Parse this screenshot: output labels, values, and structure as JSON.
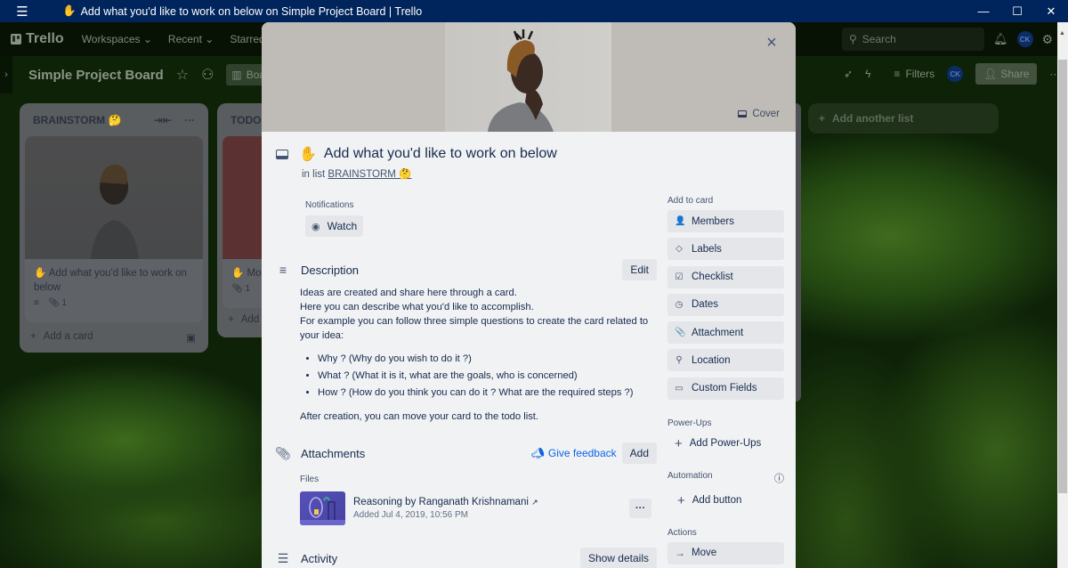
{
  "titlebar": {
    "title": "Add what you'd like to work on below on Simple Project Board | Trello",
    "title_emoji": "✋",
    "menu_icon": "hamburger-icon",
    "minimize": "—",
    "maximize": "☐",
    "close": "✕"
  },
  "topnav": {
    "brand": "Trello",
    "items": [
      {
        "label": "Workspaces",
        "chevron": "⌄"
      },
      {
        "label": "Recent",
        "chevron": "⌄"
      },
      {
        "label": "Starred",
        "chevron": "⌄"
      }
    ],
    "search_placeholder": "Search",
    "avatar_initials": "CK"
  },
  "board": {
    "name": "Simple Project Board",
    "view_button": "Board",
    "filters_label": "Filters",
    "member_initials": "CK",
    "share_label": "Share",
    "add_list_label": "Add another list"
  },
  "lists": [
    {
      "title": "BRAINSTORM 🤔",
      "card": {
        "title": "✋ Add what you'd like to work on below",
        "attachment_count": "1"
      },
      "add_card_label": "Add a card"
    },
    {
      "title": "TODO",
      "card": {
        "title": "✋ Mo",
        "attachment_count": "1"
      },
      "add_card_label": "Add"
    }
  ],
  "modal": {
    "cover_label": "Cover",
    "close_icon": "×",
    "title_emoji": "✋",
    "title": "Add what you'd like to work on below",
    "in_list_prefix": "in list",
    "list_name": "BRAINSTORM 🤔",
    "notifications_label": "Notifications",
    "watch_label": "Watch",
    "description": {
      "heading": "Description",
      "edit_label": "Edit",
      "lines": [
        "Ideas are created and share here through a card.",
        "Here you can describe what you'd like to accomplish.",
        "For example you can follow three simple questions to create the card related to your idea:"
      ],
      "bullets": [
        "Why ? (Why do you wish to do it ?)",
        "What ? (What it is it, what are the goals, who is concerned)",
        "How ? (How do you think you can do it ? What are the required steps ?)"
      ],
      "footer": "After creation, you can move your card to the todo list."
    },
    "attachments": {
      "heading": "Attachments",
      "feedback_label": "Give feedback",
      "add_label": "Add",
      "files_label": "Files",
      "file_name": "Reasoning by Ranganath Krishnamani",
      "file_link_icon": "↗",
      "file_added": "Added Jul 4, 2019, 10:56 PM",
      "more_label": "···"
    },
    "activity": {
      "heading": "Activity",
      "show_details_label": "Show details"
    },
    "sidebar": {
      "add_to_card_label": "Add to card",
      "items": [
        {
          "label": "Members",
          "icon": "👤"
        },
        {
          "label": "Labels",
          "icon": "◇"
        },
        {
          "label": "Checklist",
          "icon": "☑"
        },
        {
          "label": "Dates",
          "icon": "◷"
        },
        {
          "label": "Attachment",
          "icon": "📎"
        },
        {
          "label": "Location",
          "icon": "⚲"
        },
        {
          "label": "Custom Fields",
          "icon": "▭"
        }
      ],
      "powerups_label": "Power-Ups",
      "add_powerups_label": "Add Power-Ups",
      "automation_label": "Automation",
      "add_button_label": "Add button",
      "actions_label": "Actions",
      "move_label": "Move"
    }
  }
}
